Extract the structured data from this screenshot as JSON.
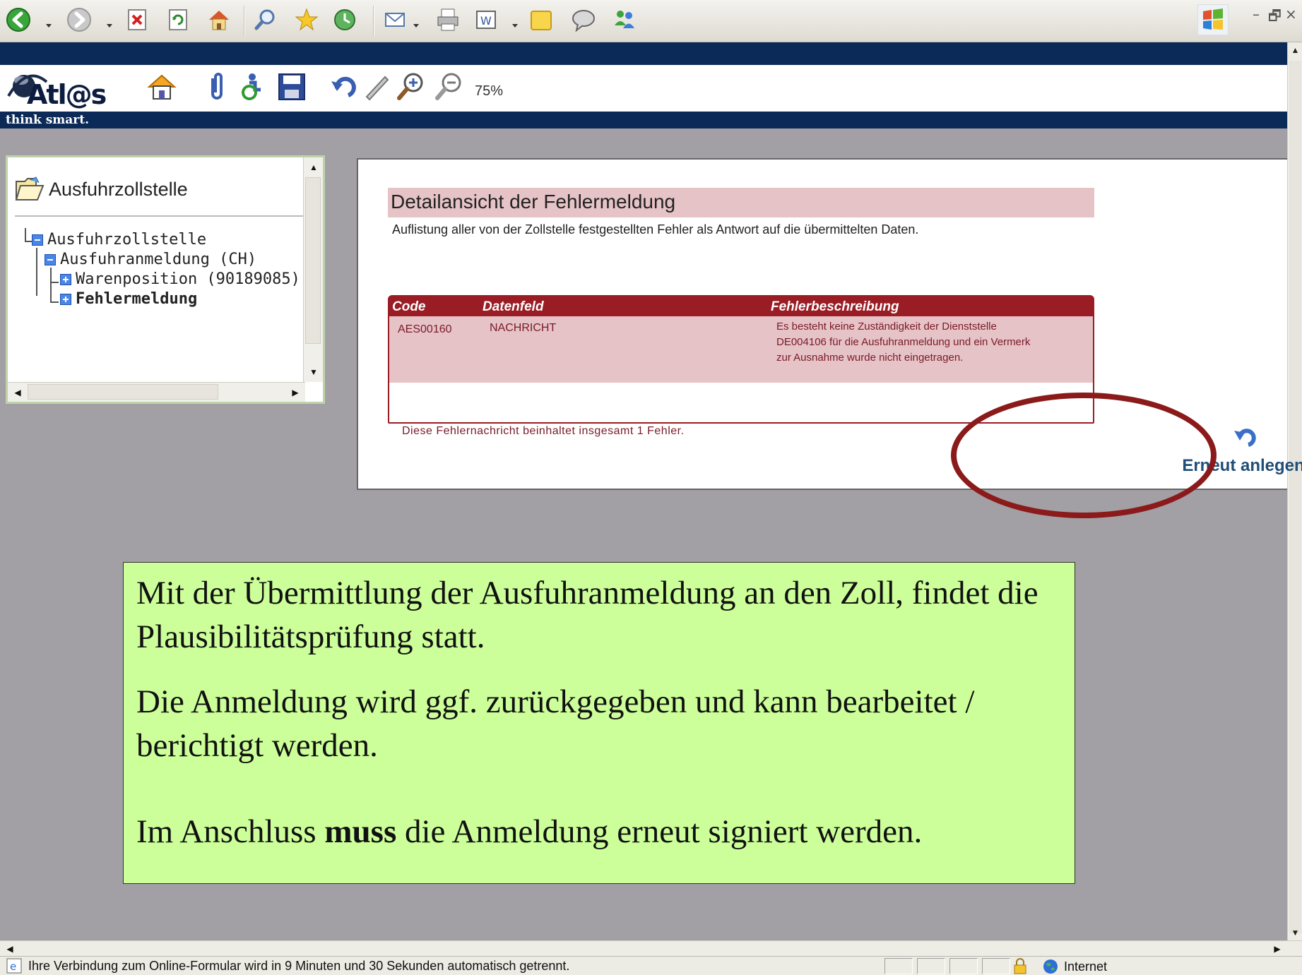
{
  "browser": {
    "toolbar_icons": [
      "back-icon",
      "forward-icon",
      "stop-icon",
      "refresh-icon",
      "home-icon",
      "search-icon",
      "favorites-icon",
      "history-icon",
      "mail-icon",
      "print-icon",
      "edit-icon",
      "folder-icon",
      "discuss-icon",
      "messenger-icon"
    ],
    "window_controls": {
      "minimize": "–",
      "restore": "🗗",
      "close": "×"
    }
  },
  "atlas": {
    "logo": "Atl@s",
    "tagline": "think smart.",
    "tools": [
      "home-icon",
      "attachment-icon",
      "accessibility-icon",
      "save-icon",
      "undo-icon",
      "edit-pen-icon",
      "zoom-in-icon",
      "zoom-out-icon"
    ],
    "zoom": "75%"
  },
  "tree": {
    "title": "Ausfuhrzollstelle",
    "nodes": [
      {
        "label": "Ausfuhrzollstelle"
      },
      {
        "label": "Ausfuhranmeldung (CH)"
      },
      {
        "label": "Warenposition (90189085)"
      },
      {
        "label": "Fehlermeldung"
      }
    ]
  },
  "detail": {
    "title": "Detailansicht der Fehlermeldung",
    "description": "Auflistung aller von der Zollstelle festgestellten Fehler als Antwort auf die übermittelten Daten.",
    "table": {
      "headers": [
        "Code",
        "Datenfeld",
        "Fehlerbeschreibung"
      ],
      "rows": [
        {
          "code": "AES00160",
          "field": "NACHRICHT",
          "description_lines": [
            "Es besteht keine Zuständigkeit der Dienststelle",
            "DE004106 für die Ausfuhranmeldung und ein Vermerk",
            "zur Ausnahme wurde nicht eingetragen."
          ]
        }
      ]
    },
    "footer": "Diese Fehlernachricht beinhaltet insgesamt 1 Fehler.",
    "retry_label": "Erneut anlegen"
  },
  "info": {
    "p1": "Mit der Übermittlung der Ausfuhranmeldung an den Zoll, findet die Plausibilitätsprüfung statt.",
    "p2": "Die Anmeldung wird ggf. zurückgegeben und kann bearbeitet / berichtigt werden.",
    "p3_before": "Im Anschluss ",
    "p3_bold": "muss",
    "p3_after": " die Anmeldung erneut signiert werden."
  },
  "status": {
    "text": "Ihre Verbindung zum Online-Formular wird in 9 Minuten und 30 Sekunden automatisch getrennt.",
    "zone": "Internet"
  },
  "colors": {
    "atlas_navy": "#0c2a57",
    "error_red": "#9a1c24",
    "error_row": "#e6c3c7",
    "info_green": "#ccff99",
    "highlight": "#8b1a1a"
  }
}
